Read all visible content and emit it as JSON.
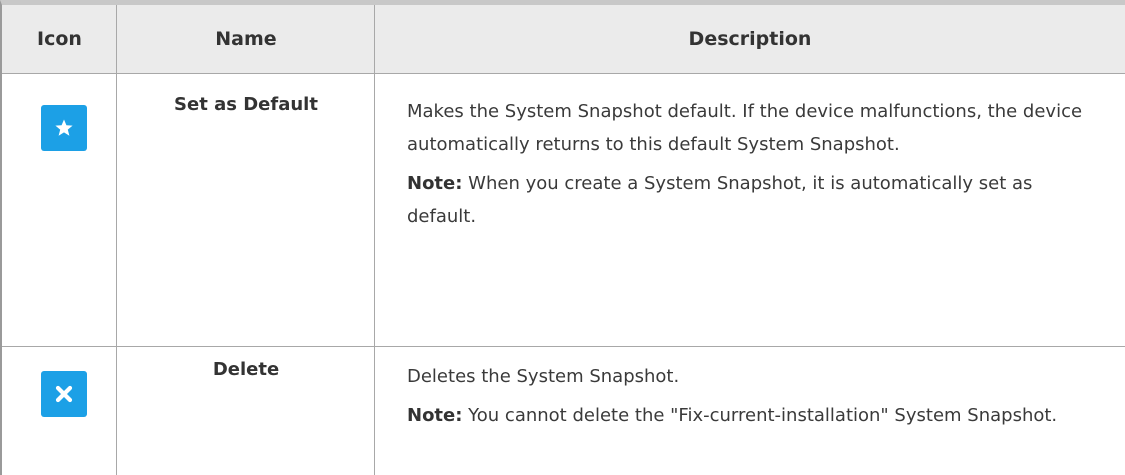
{
  "table": {
    "headers": {
      "icon": "Icon",
      "name": "Name",
      "description": "Description"
    },
    "rows": [
      {
        "icon": "star-icon",
        "name": "Set as Default",
        "description": "Makes the System Snapshot default. If the device malfunctions, the device automatically returns to this default System Snapshot.",
        "note_label": "Note:",
        "note_text": " When you create a System Snapshot, it is automatically set as default."
      },
      {
        "icon": "close-icon",
        "name": "Delete",
        "description": "Deletes the System Snapshot.",
        "note_label": "Note:",
        "note_text": " You cannot delete the \"Fix-current-installation\" System Snapshot."
      }
    ]
  },
  "colors": {
    "icon_background": "#1ca0e6",
    "header_background": "#ebebeb",
    "border": "#a8a8a8"
  }
}
